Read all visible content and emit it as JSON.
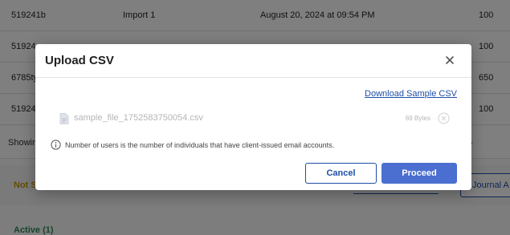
{
  "background": {
    "rows": [
      {
        "id": "519241b",
        "name": "Import 1",
        "date": "August 20, 2024 at 09:54 PM",
        "count": "100"
      },
      {
        "id": "51924",
        "name": "",
        "date": "",
        "count": "100"
      },
      {
        "id": "6785ty",
        "name": "",
        "date": "",
        "count": "650"
      },
      {
        "id": "51924",
        "name": "",
        "date": "",
        "count": "100"
      }
    ],
    "footer_text": "Showin",
    "pagination_text": "5",
    "not_started_label": "Not S",
    "journal_button": "Journal A",
    "active_label": "Active (1)"
  },
  "modal": {
    "title": "Upload CSV",
    "close_icon": "close-icon",
    "download_link": "Download Sample CSV",
    "file": {
      "name": "sample_file_1752583750054.csv",
      "size": "69 Bytes",
      "icon": "file-icon",
      "remove_icon": "close-circle-icon"
    },
    "info": {
      "icon": "info-icon",
      "text": "Number of users is the number of individuals that have client-issued email accounts."
    },
    "cancel_label": "Cancel",
    "proceed_label": "Proceed"
  },
  "colors": {
    "accent": "#1e4fa8",
    "proceed_bg": "#4a6fd1",
    "overlay": "rgba(0,0,0,0.5)"
  }
}
